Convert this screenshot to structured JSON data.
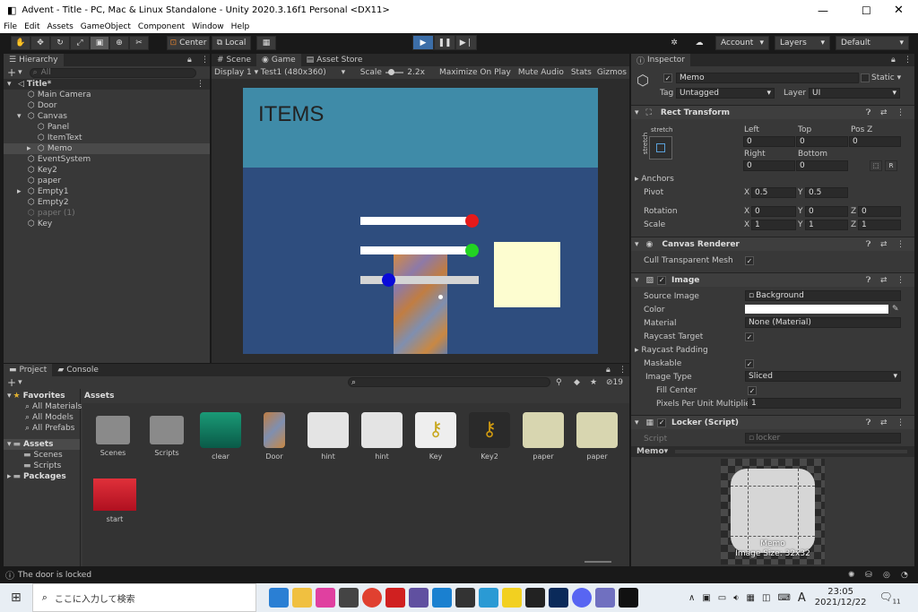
{
  "window": {
    "title": "Advent - Title - PC, Mac & Linux Standalone - Unity 2020.3.16f1 Personal <DX11>"
  },
  "menu": [
    "File",
    "Edit",
    "Assets",
    "GameObject",
    "Component",
    "Window",
    "Help"
  ],
  "toolbar": {
    "pivot": "Center",
    "space": "Local",
    "account": "Account",
    "layers": "Layers",
    "layout": "Default"
  },
  "hierarchy": {
    "tab": "Hierarchy",
    "search_placeholder": "All",
    "items": [
      {
        "label": "Title*",
        "indent": 0
      },
      {
        "label": "Main Camera",
        "indent": 1
      },
      {
        "label": "Door",
        "indent": 1
      },
      {
        "label": "Canvas",
        "indent": 1
      },
      {
        "label": "Panel",
        "indent": 2
      },
      {
        "label": "ItemText",
        "indent": 2
      },
      {
        "label": "Memo",
        "indent": 2
      },
      {
        "label": "EventSystem",
        "indent": 1
      },
      {
        "label": "Key2",
        "indent": 1
      },
      {
        "label": "paper",
        "indent": 1
      },
      {
        "label": "Empty1",
        "indent": 1
      },
      {
        "label": "Empty2",
        "indent": 1
      },
      {
        "label": "paper (1)",
        "indent": 1
      },
      {
        "label": "Key",
        "indent": 1
      }
    ]
  },
  "scene_tabs": {
    "scene": "Scene",
    "game": "Game",
    "store": "Asset Store"
  },
  "game_bar": {
    "display": "Display 1",
    "resolution": "Test1 (480x360)",
    "scale_label": "Scale",
    "scale_value": "2.2x",
    "maximize": "Maximize On Play",
    "mute": "Mute Audio",
    "stats": "Stats",
    "gizmos": "Gizmos"
  },
  "game_view": {
    "items_text": "ITEMS",
    "colors": {
      "header": "#3f8ba8",
      "body": "#2e4d7e",
      "memo": "#fdfdd0",
      "red": "#e51a1a",
      "green": "#22d322",
      "blue": "#0a0ad8"
    }
  },
  "project": {
    "tab_project": "Project",
    "tab_console": "Console",
    "hidden_count": "19",
    "favorites": "Favorites",
    "fav_items": [
      "All Materials",
      "All Models",
      "All Prefabs"
    ],
    "assets": "Assets",
    "asset_folders": [
      "Scenes",
      "Scripts"
    ],
    "packages": "Packages",
    "breadcrumb": "Assets",
    "grid": [
      "Scenes",
      "Scripts",
      "clear",
      "Door",
      "hint",
      "hint",
      "Key",
      "Key2",
      "paper",
      "paper",
      "start"
    ]
  },
  "inspector": {
    "tab": "Inspector",
    "object_name": "Memo",
    "static": "Static",
    "tag_label": "Tag",
    "tag": "Untagged",
    "layer_label": "Layer",
    "layer": "UI",
    "rect": {
      "title": "Rect Transform",
      "stretch": "stretch",
      "left": "Left",
      "top": "Top",
      "posz": "Pos Z",
      "left_v": "0",
      "top_v": "0",
      "posz_v": "0",
      "right": "Right",
      "bottom": "Bottom",
      "right_v": "0",
      "bottom_v": "0",
      "r_btn": "R"
    },
    "anchors": "Anchors",
    "pivot": {
      "label": "Pivot",
      "x": "0.5",
      "y": "0.5"
    },
    "rotation": {
      "label": "Rotation",
      "x": "0",
      "y": "0",
      "z": "0"
    },
    "scale": {
      "label": "Scale",
      "x": "1",
      "y": "1",
      "z": "1"
    },
    "canvas_renderer": "Canvas Renderer",
    "cull": "Cull Transparent Mesh",
    "image": {
      "title": "Image",
      "source_label": "Source Image",
      "source": "Background",
      "color_label": "Color",
      "material_label": "Material",
      "material": "None (Material)",
      "raycast": "Raycast Target",
      "padding": "Raycast Padding",
      "maskable": "Maskable",
      "type_label": "Image Type",
      "type": "Sliced",
      "fill": "Fill Center",
      "ppu_label": "Pixels Per Unit Multiplier",
      "ppu": "1"
    },
    "locker": {
      "title": "Locker (Script)",
      "script_label": "Script",
      "script": "locker"
    },
    "preview": {
      "label": "Memo",
      "name": "Memo",
      "size": "Image Size: 32x32"
    }
  },
  "status": "The door is locked",
  "taskbar": {
    "search": "ここに入力して検索",
    "time": "23:05",
    "date": "2021/12/22",
    "ime": "A",
    "badge": "11"
  }
}
